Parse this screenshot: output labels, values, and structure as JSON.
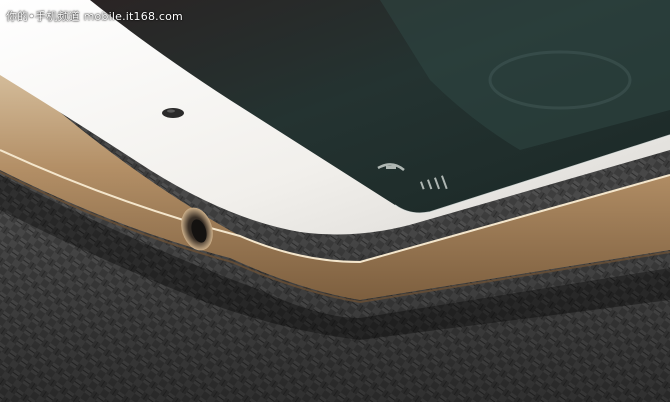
{
  "photo": {
    "subject": "smartphone-corner-closeup"
  },
  "watermark": {
    "text": "你的•手机频道 mobile.it168.com"
  },
  "colors": {
    "background_carbon": "#3b3b3b",
    "phone_white": "#f2f1ee",
    "gold_frame": "#b99a74",
    "screen_dark": "#1f2a2b"
  }
}
